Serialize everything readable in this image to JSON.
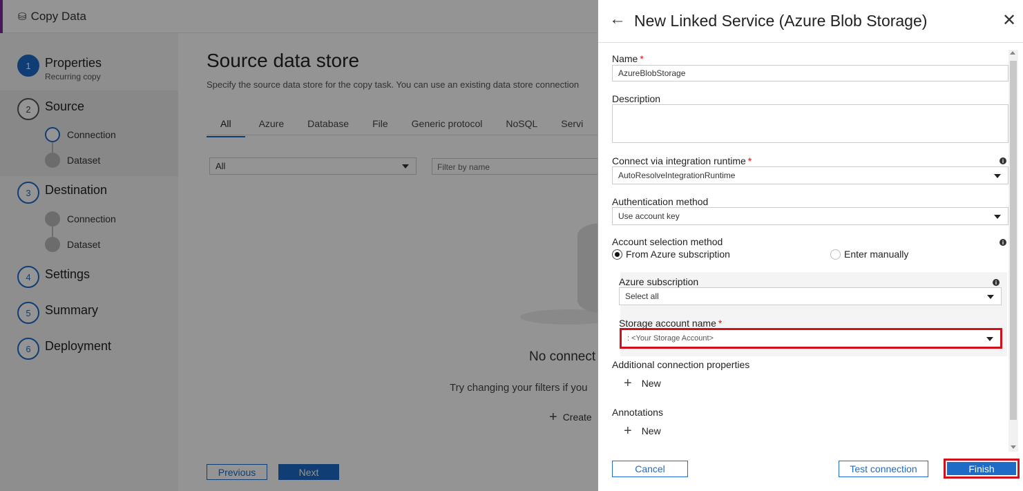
{
  "app": {
    "title": "Copy Data"
  },
  "steps": [
    {
      "num": "1",
      "label": "Properties",
      "sub": "Recurring copy"
    },
    {
      "num": "2",
      "label": "Source",
      "substeps": [
        "Connection",
        "Dataset"
      ]
    },
    {
      "num": "3",
      "label": "Destination",
      "substeps": [
        "Connection",
        "Dataset"
      ]
    },
    {
      "num": "4",
      "label": "Settings"
    },
    {
      "num": "5",
      "label": "Summary"
    },
    {
      "num": "6",
      "label": "Deployment"
    }
  ],
  "main": {
    "title": "Source data store",
    "description": "Specify the source data store for the copy task. You can use an existing data store connection",
    "tabs": [
      "All",
      "Azure",
      "Database",
      "File",
      "Generic protocol",
      "NoSQL",
      "Servi"
    ],
    "filter_type_value": "All",
    "filter_name_placeholder": "Filter by name",
    "empty_title": "No connect",
    "empty_hint": "Try changing your filters if you",
    "create_label": "Create",
    "previous_label": "Previous",
    "next_label": "Next"
  },
  "panel": {
    "title": "New Linked Service (Azure Blob Storage)",
    "name_label": "Name",
    "name_value": "AzureBlobStorage",
    "description_label": "Description",
    "runtime_label": "Connect via integration runtime",
    "runtime_value": "AutoResolveIntegrationRuntime",
    "auth_label": "Authentication method",
    "auth_value": "Use account key",
    "account_selection_label": "Account selection method",
    "radio_from_subscription": "From Azure subscription",
    "radio_enter_manually": "Enter manually",
    "subscription_label": "Azure subscription",
    "subscription_value": "Select all",
    "storage_account_label": "Storage account name",
    "storage_account_value": ": <Your Storage Account>",
    "additional_props_label": "Additional connection properties",
    "new_label": "New",
    "annotations_label": "Annotations",
    "cancel_label": "Cancel",
    "test_connection_label": "Test connection",
    "finish_label": "Finish",
    "required_mark": "*",
    "info_glyph": "i"
  },
  "colors": {
    "accent": "#1d6ac7",
    "highlight": "#d0101b"
  }
}
